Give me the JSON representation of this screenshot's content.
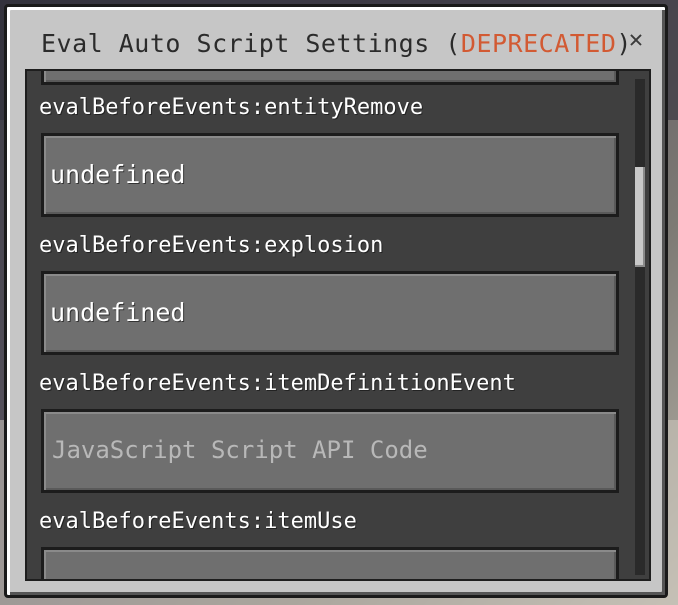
{
  "dialog": {
    "title_prefix": "Eval Auto Script Settings (",
    "title_deprecated": "DEPRECATED",
    "title_suffix": ")",
    "close_glyph": "✕"
  },
  "fields": [
    {
      "label": "",
      "value": "",
      "placeholder": ""
    },
    {
      "label": "evalBeforeEvents:entityRemove",
      "value": "undefined",
      "placeholder": ""
    },
    {
      "label": "evalBeforeEvents:explosion",
      "value": "undefined",
      "placeholder": ""
    },
    {
      "label": "evalBeforeEvents:itemDefinitionEvent",
      "value": "",
      "placeholder": "JavaScript Script API Code"
    },
    {
      "label": "evalBeforeEvents:itemUse",
      "value": "",
      "placeholder": ""
    }
  ],
  "scrollbar": {
    "position": 0.18
  },
  "colors": {
    "deprecated": "#d25a33",
    "panel": "#3f3f3f",
    "field": "#6f6f6f"
  }
}
